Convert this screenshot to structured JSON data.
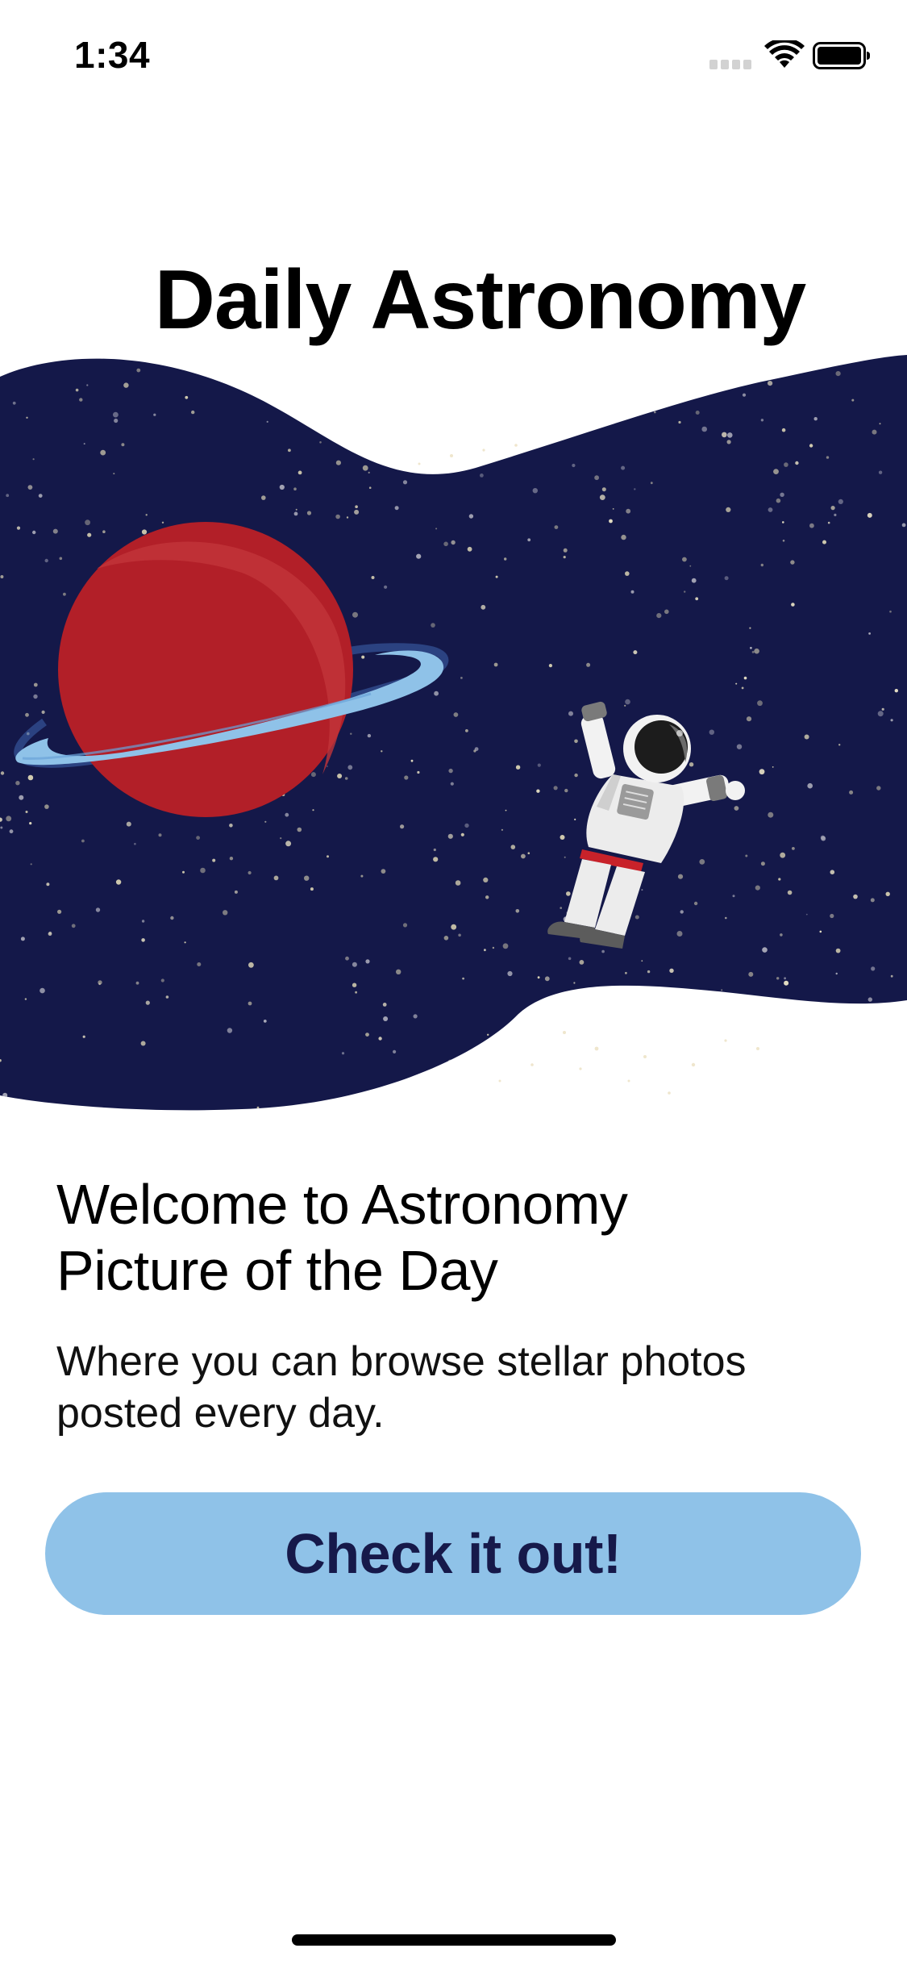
{
  "status_bar": {
    "time": "1:34"
  },
  "header": {
    "title": "Daily Astronomy"
  },
  "hero": {
    "icons": [
      "planet-icon",
      "astronaut-icon",
      "stars"
    ]
  },
  "welcome": {
    "heading_line1": "Welcome to Astronomy",
    "heading_line2": "Picture of the Day",
    "subtitle_line1": "Where you can browse stellar photos",
    "subtitle_line2": "posted every day."
  },
  "cta": {
    "label": "Check it out!"
  },
  "colors": {
    "space_navy": "#141849",
    "planet_red": "#b52228",
    "ring_blue": "#8fc2e8",
    "button_bg": "#8fc2e8",
    "button_text": "#16194a"
  }
}
